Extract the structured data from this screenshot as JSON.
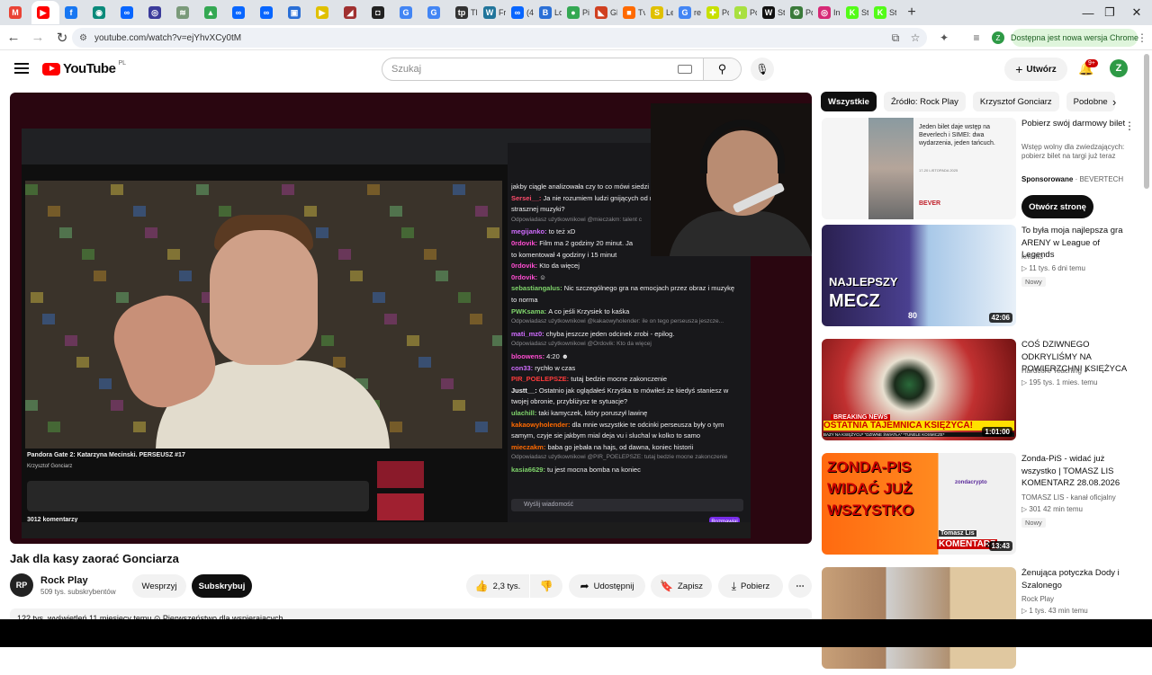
{
  "browser": {
    "tabs": [
      {
        "icon": "gmail-icon",
        "color": "#ea4335",
        "glyph": "M",
        "label": ""
      },
      {
        "icon": "youtube-icon",
        "color": "#ff0000",
        "glyph": "▶",
        "label": ""
      },
      {
        "icon": "facebook-icon",
        "color": "#1877f2",
        "glyph": "f",
        "label": ""
      },
      {
        "icon": "app-icon",
        "color": "#0a8a7a",
        "glyph": "◉",
        "label": ""
      },
      {
        "icon": "meta-icon",
        "color": "#0866ff",
        "glyph": "∞",
        "label": ""
      },
      {
        "icon": "app-icon",
        "color": "#3b3b9b",
        "glyph": "◎",
        "label": ""
      },
      {
        "icon": "app-icon",
        "color": "#7a9a7a",
        "glyph": "≋",
        "label": ""
      },
      {
        "icon": "drive-icon",
        "color": "#34a853",
        "glyph": "▲",
        "label": ""
      },
      {
        "icon": "meta-icon",
        "color": "#0866ff",
        "glyph": "∞",
        "label": ""
      },
      {
        "icon": "meta-icon",
        "color": "#0866ff",
        "glyph": "∞",
        "label": ""
      },
      {
        "icon": "app-icon",
        "color": "#2a6fd6",
        "glyph": "▣",
        "label": ""
      },
      {
        "icon": "app-icon",
        "color": "#e0c000",
        "glyph": "▶",
        "label": ""
      },
      {
        "icon": "app-icon",
        "color": "#a03030",
        "glyph": "◢",
        "label": ""
      },
      {
        "icon": "app-icon",
        "color": "#222",
        "glyph": "◘",
        "label": ""
      },
      {
        "icon": "google-icon",
        "color": "#4285f4",
        "glyph": "G",
        "label": ""
      },
      {
        "icon": "google-icon",
        "color": "#4285f4",
        "glyph": "G",
        "label": ""
      },
      {
        "icon": "app-icon",
        "color": "#333",
        "glyph": "tp",
        "label": "Tl"
      },
      {
        "icon": "wordpress-icon",
        "color": "#21759b",
        "glyph": "W",
        "label": "Fr"
      },
      {
        "icon": "meta-icon",
        "color": "#0866ff",
        "glyph": "∞",
        "label": "(4"
      },
      {
        "icon": "app-icon",
        "color": "#2a6fd6",
        "glyph": "B",
        "label": "Lo"
      },
      {
        "icon": "maps-icon",
        "color": "#34a853",
        "glyph": "●",
        "label": "Pi"
      },
      {
        "icon": "app-icon",
        "color": "#d04020",
        "glyph": "◣",
        "label": "Gl"
      },
      {
        "icon": "app-icon",
        "color": "#ff6a00",
        "glyph": "■",
        "label": "Tv"
      },
      {
        "icon": "app-icon",
        "color": "#e0c000",
        "glyph": "S",
        "label": "Le"
      },
      {
        "icon": "google-icon",
        "color": "#4285f4",
        "glyph": "G",
        "label": "re"
      },
      {
        "icon": "app-icon",
        "color": "#c8e000",
        "glyph": "✚",
        "label": "Pc"
      },
      {
        "icon": "app-icon",
        "color": "#a8e040",
        "glyph": "◐",
        "label": "Pc"
      },
      {
        "icon": "app-icon",
        "color": "#111",
        "glyph": "W",
        "label": "St"
      },
      {
        "icon": "app-icon",
        "color": "#3a7a3a",
        "glyph": "⚙",
        "label": "Pc"
      },
      {
        "icon": "instagram-icon",
        "color": "#d62976",
        "glyph": "◎",
        "label": "In"
      },
      {
        "icon": "kick-icon",
        "color": "#53fc18",
        "glyph": "K",
        "label": "St"
      },
      {
        "icon": "kick-icon",
        "color": "#53fc18",
        "glyph": "K",
        "label": "St"
      }
    ],
    "url": "youtube.com/watch?v=ejYhvXCy0tM",
    "update_pill": "Dostępna jest nowa wersja Chrome"
  },
  "header": {
    "logo_word": "YouTube",
    "logo_country": "PL",
    "search_placeholder": "Szukaj",
    "create_label": "Utwórz",
    "notif_count": "9+",
    "avatar_letter": "Z"
  },
  "player": {
    "recorded_title": "Pandora Gate 2: Katarzyna Mecinski. PERSEUSZ #17",
    "recorded_channel": "Krzysztof Gonciarz",
    "recorded_comments": "3012 komentarzy",
    "chat": [
      {
        "name": "",
        "text": "jakby ciągle analizowała czy to co mówi  siedzi",
        "color": "#efeff1",
        "reply": false
      },
      {
        "name": "Sersei__:",
        "text": "Ja nie rozumiem ludzi gnijących od re",
        "color": "#ff4d6d",
        "reply": false
      },
      {
        "name": "",
        "text": "strasznej muzyki?",
        "color": "#efeff1",
        "reply": false
      },
      {
        "name": "",
        "text": "Odpowiadasz użytkownikowi @mieczakm: talent c",
        "color": "#8a8a8e",
        "reply": true
      },
      {
        "name": "megijanko:",
        "text": "to też xD",
        "color": "#d06cff",
        "reply": false
      },
      {
        "name": "0rdovik:",
        "text": "Film ma 2 godziny 20 minut. Ja",
        "color": "#ff4dd2",
        "reply": false
      },
      {
        "name": "",
        "text": "to komentował 4 godziny i 15 minut",
        "color": "#efeff1",
        "reply": false
      },
      {
        "name": "0rdovik:",
        "text": "Kto da więcej",
        "color": "#ff4dd2",
        "reply": false
      },
      {
        "name": "0rdovik:",
        "text": "☺",
        "color": "#ff4dd2",
        "reply": false
      },
      {
        "name": "sebastiangalus:",
        "text": "Nic szczególnego gra na emocjach przez obraz i muzykę",
        "color": "#7fd46b",
        "reply": false
      },
      {
        "name": "",
        "text": "to norma",
        "color": "#efeff1",
        "reply": false
      },
      {
        "name": "PWKsama:",
        "text": "A co jeśli Krzysiek to kaśka",
        "color": "#7fd46b",
        "reply": false
      },
      {
        "name": "",
        "text": "Odpowiadasz użytkownikowi @kakaowyholender: ile on tego perseusza jeszcze...",
        "color": "#8a8a8e",
        "reply": true
      },
      {
        "name": "mati_mz0:",
        "text": "chyba jeszcze jeden odcinek zrobi - epilog.",
        "color": "#d06cff",
        "reply": false
      },
      {
        "name": "",
        "text": "Odpowiadasz użytkownikowi @Ordovik: Kto da więcej",
        "color": "#8a8a8e",
        "reply": true
      },
      {
        "name": "bloowens:",
        "text": "4:20 ☻",
        "color": "#ff4dd2",
        "reply": false
      },
      {
        "name": "con33:",
        "text": "rychło w czas",
        "color": "#d06cff",
        "reply": false
      },
      {
        "name": "PIR_POELEPSZE:",
        "text": "tutaj bedzie mocne zakonczenie",
        "color": "#ff3b3b",
        "reply": false
      },
      {
        "name": "Justt__:",
        "text": "Ostatnio jak oglądałeś Krzyśka to mówiłeś że kiedyś staniesz w",
        "color": "#efeff1",
        "reply": false
      },
      {
        "name": "",
        "text": "twojej obronie, przybliżysz te sytuacje?",
        "color": "#efeff1",
        "reply": false
      },
      {
        "name": "ulachill:",
        "text": "taki kamyczek, który poruszył lawinę",
        "color": "#7fd46b",
        "reply": false
      },
      {
        "name": "kakaowyholender:",
        "text": "dla mnie wszystkie te odcinki perseusza były o tym",
        "color": "#ff6a00",
        "reply": false
      },
      {
        "name": "",
        "text": "samym, czyje sie jakbym mial deja vu i sluchal w kolko to samo",
        "color": "#efeff1",
        "reply": false
      },
      {
        "name": "mieczakm:",
        "text": "baba go jebała na hajs, od dawna, koniec historii",
        "color": "#ff6a00",
        "reply": false
      },
      {
        "name": "",
        "text": "Odpowiadasz użytkownikowi @PIR_POELEPSZE: tutaj bedzie mocne zakonczenie",
        "color": "#8a8a8e",
        "reply": true
      },
      {
        "name": "kasia6629:",
        "text": "tu jest mocna bomba na koniec",
        "color": "#7fd46b",
        "reply": false
      }
    ],
    "chat_placeholder": "Wyślij wiadomość",
    "chat_send": "Rozmawiaj"
  },
  "video": {
    "title": "Jak dla kasy zaorać Gonciarza",
    "channel": "Rock Play",
    "subscribers": "509 tys. subskrybentów",
    "support_label": "Wesprzyj",
    "subscribe_label": "Subskrybuj",
    "likes": "2,3 tys.",
    "share_label": "Udostępnij",
    "save_label": "Zapisz",
    "download_label": "Pobierz",
    "description_preview": "122 tys. wyświetleń  11 miesięcy temu  ⊙ Pierwszeństwo dla wspierających"
  },
  "chips": [
    "Wszystkie",
    "Źródło: Rock Play",
    "Krzysztof Gonciarz",
    "Podobne"
  ],
  "recommendations": [
    {
      "kind": "ad",
      "title": "Pobierz swój darmowy bilet",
      "desc": "Wstęp wolny dla zwiedzających: pobierz bilet na targi już teraz",
      "sponsor_label": "Sponsorowane",
      "sponsor": "BEVERTECH",
      "cta": "Otwórz stronę",
      "thumb_text": "Jeden bilet daje wstęp na Beverlech i SIMEI: dwa wydarzenia, jeden tańcuch.",
      "thumb_date": "17-20 LISTOPADA 2025",
      "thumb_logo": "BEVER"
    },
    {
      "kind": "video",
      "title": "To była moja najlepsza gra ARENY w League of Legends",
      "channel": "kmmt3",
      "meta": "11 tys.   6 dni temu",
      "badge": "Nowy",
      "duration": "42:06",
      "thumb_text1": "NAJLEPSZY",
      "thumb_text2": "MECZ",
      "thumb_num": "80"
    },
    {
      "kind": "video",
      "title": "COŚ DZIWNEGO ODKRYLIŚMY NA POWIERZCHNI KSIĘŻYCA ...",
      "channel": "Hardcore Teaching ✔",
      "meta": "195 tys.   1 mies. temu",
      "duration": "1:01:00",
      "thumb_text1": "BREAKING NEWS",
      "thumb_text2": "OSTATNIA TAJEMNICA KSIĘŻYCA!",
      "thumb_ticker": "BAZY NA KSIĘŻYCU* \"DZIWNE ŚWIATŁA\" *TUNELE KOSMICZE*"
    },
    {
      "kind": "video",
      "title": "Zonda-PiS - widać już wszystko | TOMASZ LIS KOMENTARZ 28.08.2026",
      "channel": "TOMASZ LIS - kanał oficjalny",
      "meta": "301   42 min temu",
      "badge": "Nowy",
      "duration": "13:43",
      "thumb_text1": "ZONDA-PIS",
      "thumb_text2": "WIDAĆ JUŻ",
      "thumb_text3": "WSZYSTKO",
      "thumb_brand": "zondacrypto",
      "thumb_name": "Tomasz Lis",
      "thumb_tag": "KOMENTARZ",
      "thumb_date": "28.08."
    },
    {
      "kind": "video",
      "title": "Żenująca potyczka Dody i Szalonego",
      "channel": "Rock Play",
      "meta": "1 tys.   43 min temu"
    }
  ]
}
